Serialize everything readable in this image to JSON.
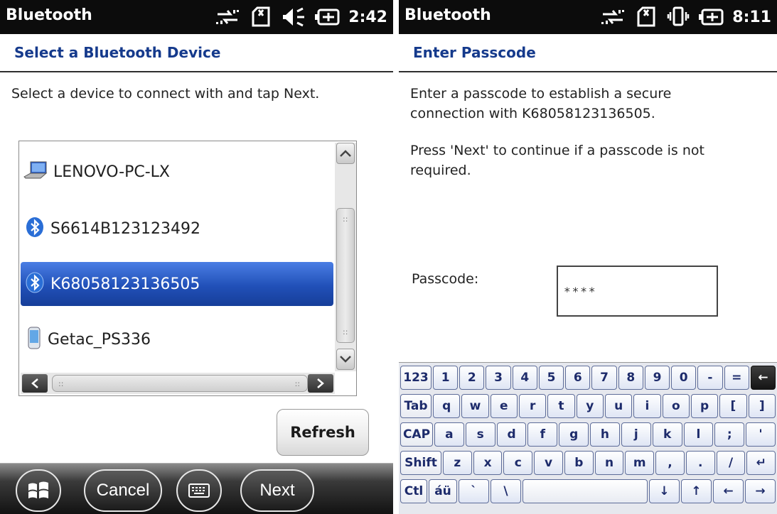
{
  "left_screen": {
    "statusbar": {
      "title": "Bluetooth",
      "time": "2:42",
      "icons": [
        "connectivity-icon",
        "no-sim-icon",
        "speaker-icon",
        "battery-charging-icon"
      ]
    },
    "heading": "Select a Bluetooth Device",
    "instruction": "Select a device to connect with and tap Next.",
    "devices": [
      {
        "name": "LENOVO-PC-LX",
        "icon": "computer-icon",
        "selected": false
      },
      {
        "name": "S6614B123123492",
        "icon": "bluetooth-icon",
        "selected": false
      },
      {
        "name": "K68058123136505",
        "icon": "bluetooth-icon",
        "selected": true
      },
      {
        "name": "Getac_PS336",
        "icon": "phone-icon",
        "selected": false
      }
    ],
    "refresh_label": "Refresh",
    "softkeys": {
      "start_icon": "windows-start-icon",
      "cancel_label": "Cancel",
      "keyboard_icon": "keyboard-icon",
      "next_label": "Next"
    }
  },
  "right_screen": {
    "statusbar": {
      "title": "Bluetooth",
      "time": "8:11",
      "icons": [
        "connectivity-icon",
        "no-sim-icon",
        "vibrate-icon",
        "battery-charging-icon"
      ]
    },
    "heading": "Enter Passcode",
    "instruction_1": "Enter a passcode to establish a secure connection with K68058123136505.",
    "instruction_2": "Press 'Next' to continue if a passcode is not required.",
    "passcode_label": "Passcode:",
    "passcode_value": "****",
    "keyboard": {
      "row1": [
        "123",
        "1",
        "2",
        "3",
        "4",
        "5",
        "6",
        "7",
        "8",
        "9",
        "0",
        "-",
        "=",
        "←"
      ],
      "row2": [
        "Tab",
        "q",
        "w",
        "e",
        "r",
        "t",
        "y",
        "u",
        "i",
        "o",
        "p",
        "[",
        "]"
      ],
      "row3": [
        "CAP",
        "a",
        "s",
        "d",
        "f",
        "g",
        "h",
        "j",
        "k",
        "l",
        ";",
        "'"
      ],
      "row4": [
        "Shift",
        "z",
        "x",
        "c",
        "v",
        "b",
        "n",
        "m",
        ",",
        ".",
        "/",
        "↵"
      ],
      "row5": [
        "Ctl",
        "áü",
        "`",
        "\\",
        "",
        "↓",
        "↑",
        "←",
        "→"
      ]
    }
  }
}
